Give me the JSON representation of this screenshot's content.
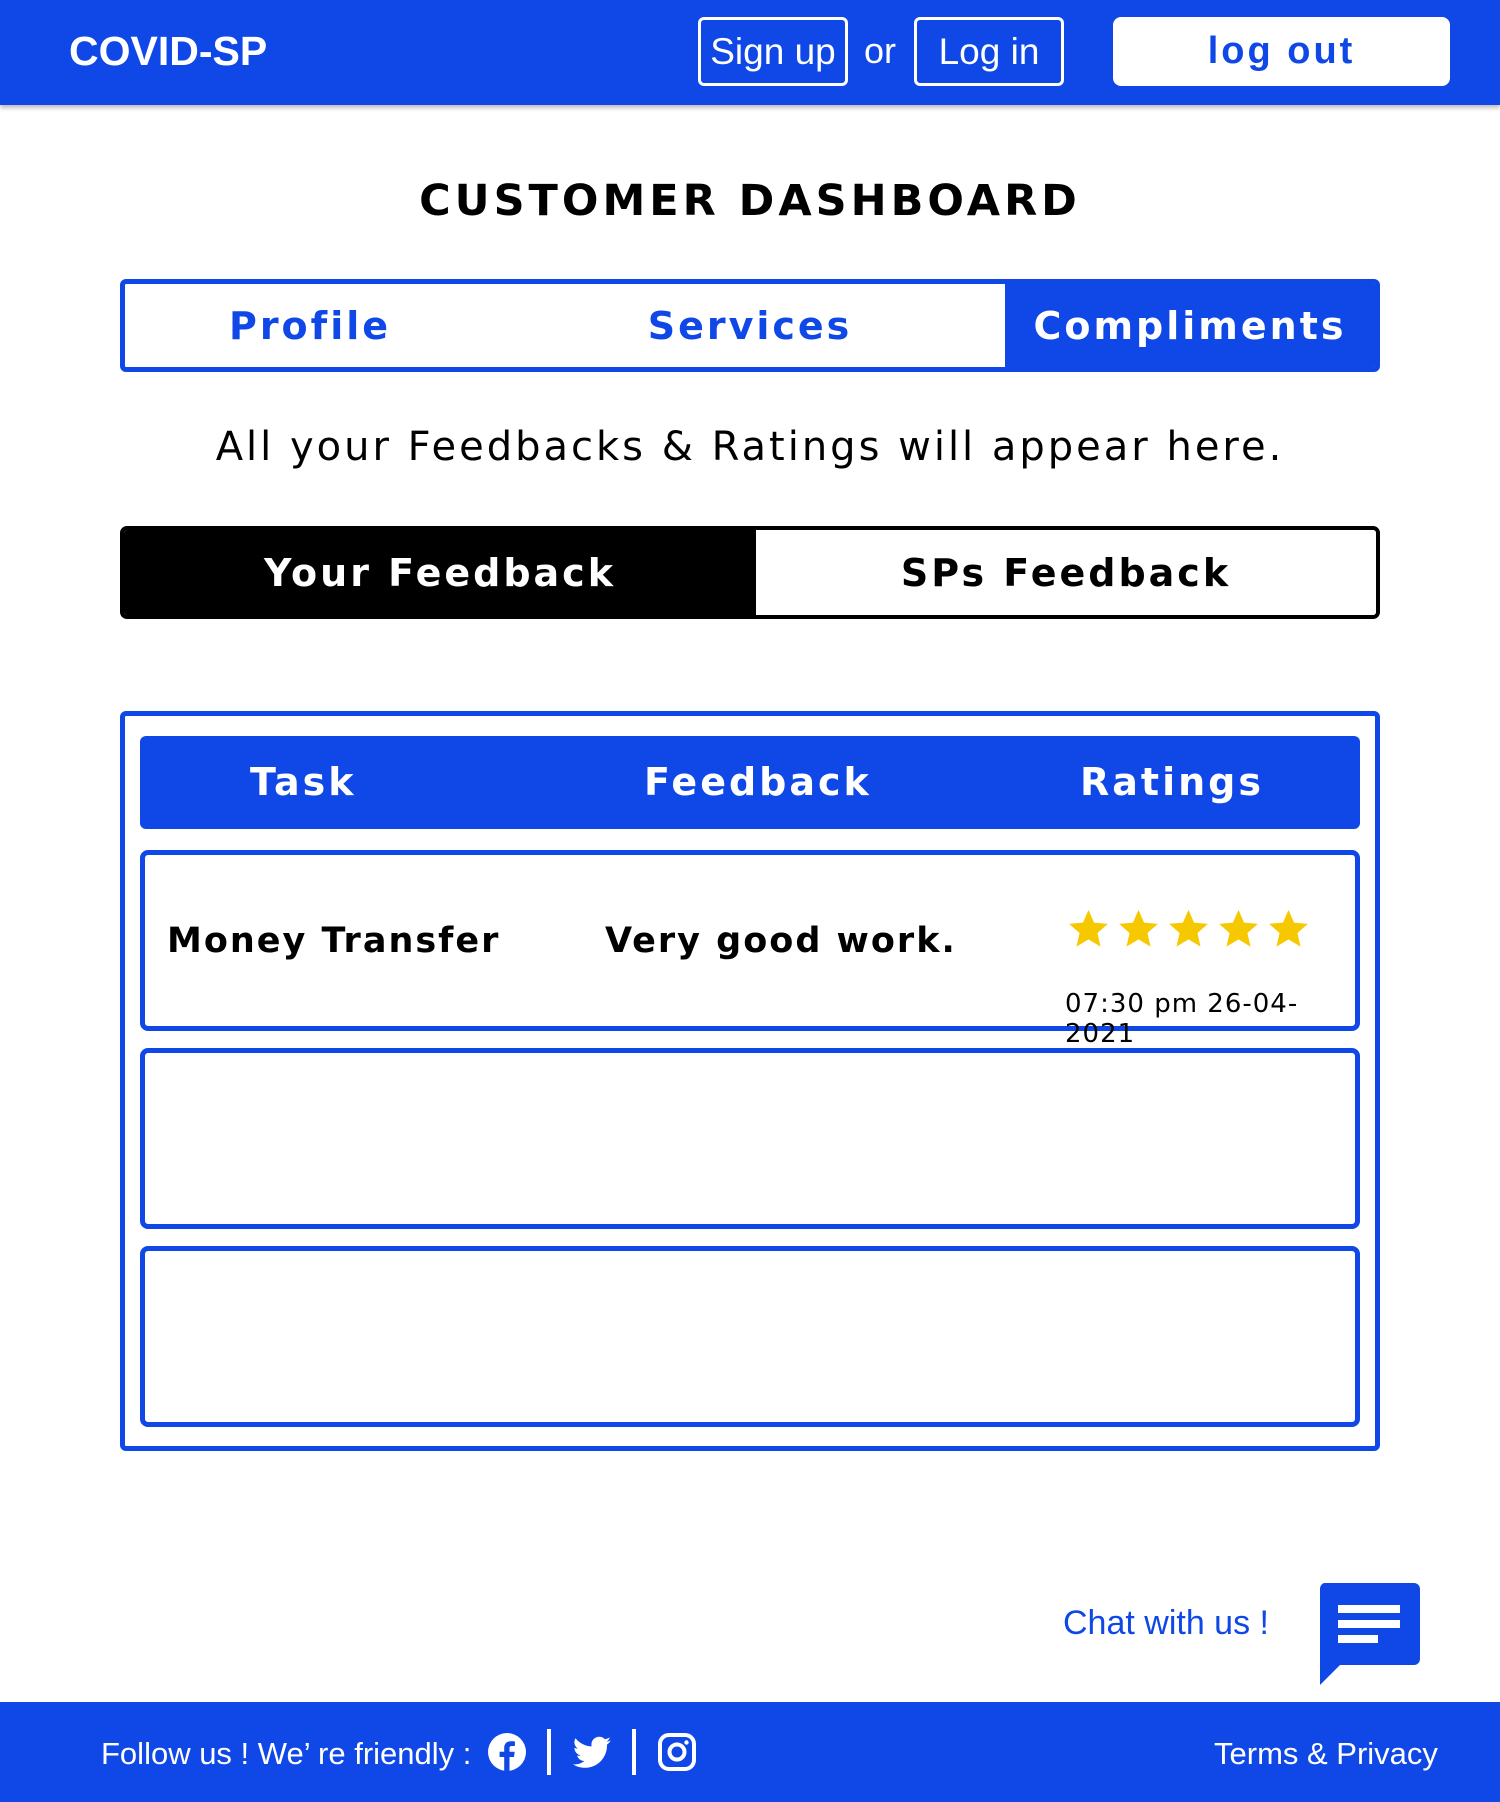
{
  "header": {
    "brand": "COVID-SP",
    "signup_label": "Sign up",
    "or_text": "or",
    "login_label": "Log in",
    "logout_label": "log out"
  },
  "page": {
    "title": "CUSTOMER DASHBOARD",
    "subtitle": "All your Feedbacks & Ratings will appear here."
  },
  "tabs": [
    {
      "label": "Profile",
      "active": false
    },
    {
      "label": "Services",
      "active": false
    },
    {
      "label": "Compliments",
      "active": true
    }
  ],
  "feedback_tabs": [
    {
      "label": "Your Feedback",
      "active": true
    },
    {
      "label": "SPs Feedback",
      "active": false
    }
  ],
  "table": {
    "columns": [
      "Task",
      "Feedback",
      "Ratings"
    ],
    "rows": [
      {
        "task": "Money Transfer",
        "feedback": "Very good work.",
        "rating": 5,
        "rating_max": 5,
        "timestamp": "07:30 pm 26-04-2021"
      },
      {
        "task": "",
        "feedback": "",
        "rating": 0,
        "timestamp": ""
      },
      {
        "task": "",
        "feedback": "",
        "rating": 0,
        "timestamp": ""
      }
    ]
  },
  "chat": {
    "label": "Chat with us !",
    "icon": "chat-icon"
  },
  "footer": {
    "follow_text": "Follow us !  We’ re friendly :",
    "social_icons": [
      "facebook-icon",
      "twitter-icon",
      "instagram-icon"
    ],
    "terms_label": "Terms & Privacy"
  },
  "colors": {
    "brand_blue": "#0f48e6",
    "star_gold": "#f6c800",
    "active_black": "#000000"
  }
}
